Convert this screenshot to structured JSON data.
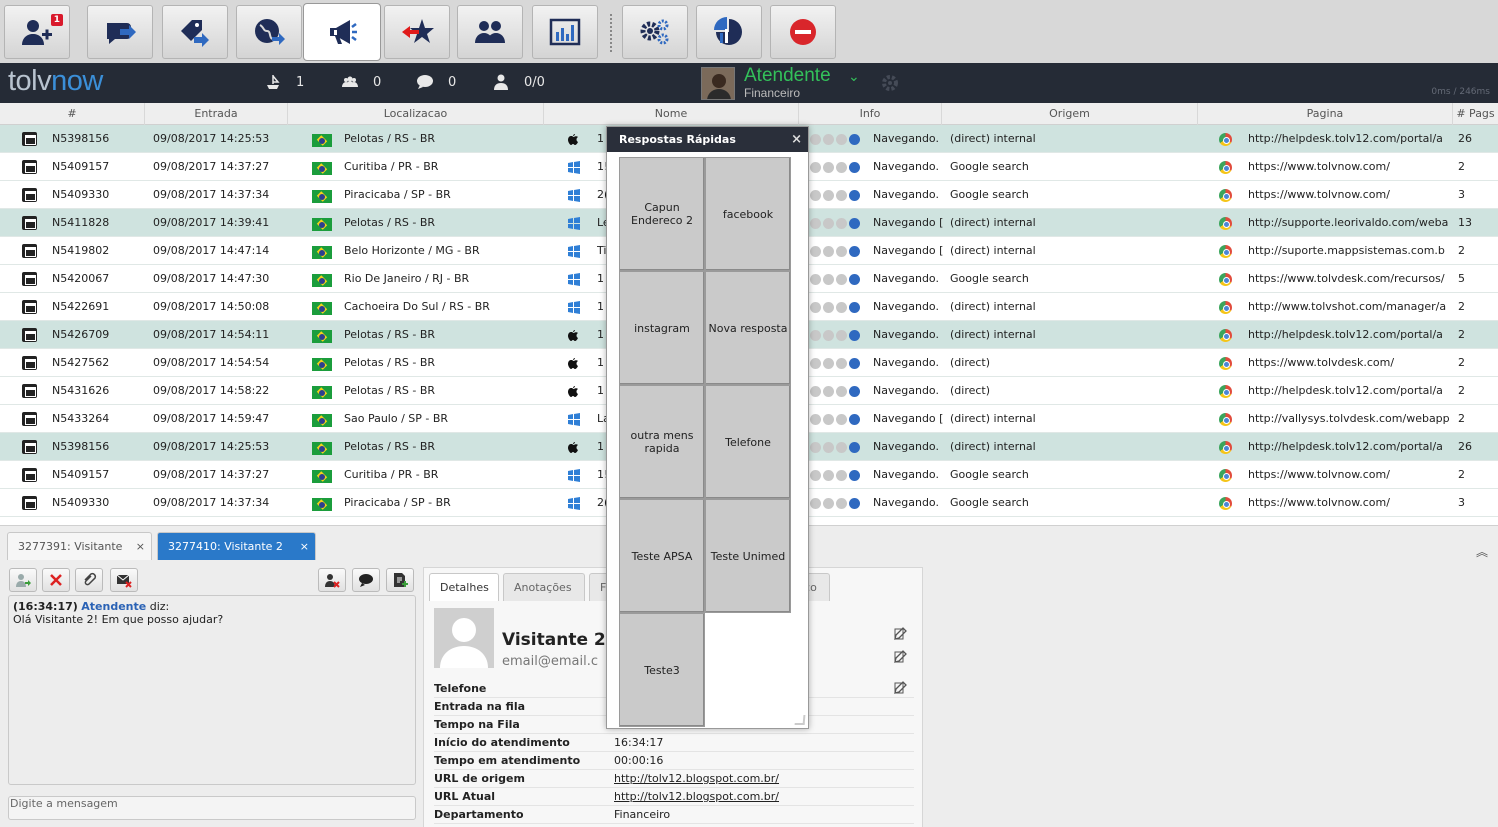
{
  "toolbar": {
    "badge": "1",
    "icons": [
      "add-user-icon",
      "chat-transfer-icon",
      "tags-icon",
      "globe-icon",
      "megaphone-icon",
      "star-icon",
      "users-icon",
      "chart-icon",
      "gears-icon",
      "pie-chart-icon",
      "stop-icon"
    ]
  },
  "status": {
    "logo_a": "tolv",
    "logo_b": "now",
    "stat1": "1",
    "stat2": "0",
    "stat3": "0",
    "stat4": "0/0",
    "agent_name": "Atendente",
    "agent_dept": "Financeiro",
    "timing": "0ms / 246ms",
    "accent": "#33c15a"
  },
  "table": {
    "headers": [
      "#",
      "Entrada",
      "Localizacao",
      "Nome",
      "Info",
      "Origem",
      "Pagina",
      "# Pags"
    ],
    "rows": [
      {
        "id": "N5398156",
        "entrada": "09/08/2017 14:25:53",
        "loc": "Pelotas / RS - BR",
        "os": "apple",
        "nome": "1",
        "info": "Navegando.",
        "origem": "(direct) internal",
        "pagina": "http://helpdesk.tolv12.com/portal/a",
        "pags": "26"
      },
      {
        "id": "N5409157",
        "entrada": "09/08/2017 14:37:27",
        "loc": "Curitiba / PR - BR",
        "os": "windows",
        "nome": "1!",
        "info": "Navegando.",
        "origem": "Google search",
        "pagina": "https://www.tolvnow.com/",
        "pags": "2"
      },
      {
        "id": "N5409330",
        "entrada": "09/08/2017 14:37:34",
        "loc": "Piracicaba / SP - BR",
        "os": "windows",
        "nome": "2(",
        "info": "Navegando.",
        "origem": "Google search",
        "pagina": "https://www.tolvnow.com/",
        "pags": "3"
      },
      {
        "id": "N5411828",
        "entrada": "09/08/2017 14:39:41",
        "loc": "Pelotas / RS - BR",
        "os": "windows",
        "nome": "Le",
        "info": "Navegando [",
        "origem": "(direct) internal",
        "pagina": "http://supporte.leorivaldo.com/weba",
        "pags": "13"
      },
      {
        "id": "N5419802",
        "entrada": "09/08/2017 14:47:14",
        "loc": "Belo Horizonte / MG - BR",
        "os": "windows",
        "nome": "Ti",
        "info": "Navegando [",
        "origem": "(direct) internal",
        "pagina": "http://suporte.mappsistemas.com.b",
        "pags": "2"
      },
      {
        "id": "N5420067",
        "entrada": "09/08/2017 14:47:30",
        "loc": "Rio De Janeiro / RJ - BR",
        "os": "windows",
        "nome": "1",
        "info": "Navegando.",
        "origem": "Google search",
        "pagina": "https://www.tolvdesk.com/recursos/",
        "pags": "5"
      },
      {
        "id": "N5422691",
        "entrada": "09/08/2017 14:50:08",
        "loc": "Cachoeira Do Sul / RS - BR",
        "os": "windows",
        "nome": "1",
        "info": "Navegando.",
        "origem": "(direct) internal",
        "pagina": "http://www.tolvshot.com/manager/a",
        "pags": "2"
      },
      {
        "id": "N5426709",
        "entrada": "09/08/2017 14:54:11",
        "loc": "Pelotas / RS - BR",
        "os": "apple",
        "nome": "1",
        "info": "Navegando.",
        "origem": "(direct) internal",
        "pagina": "http://helpdesk.tolv12.com/portal/a",
        "pags": "2"
      },
      {
        "id": "N5427562",
        "entrada": "09/08/2017 14:54:54",
        "loc": "Pelotas / RS - BR",
        "os": "apple",
        "nome": "1",
        "info": "Navegando.",
        "origem": "(direct)",
        "pagina": "https://www.tolvdesk.com/",
        "pags": "2"
      },
      {
        "id": "N5431626",
        "entrada": "09/08/2017 14:58:22",
        "loc": "Pelotas / RS - BR",
        "os": "apple",
        "nome": "1",
        "info": "Navegando.",
        "origem": "(direct)",
        "pagina": "http://helpdesk.tolv12.com/portal/a",
        "pags": "2"
      },
      {
        "id": "N5433264",
        "entrada": "09/08/2017 14:59:47",
        "loc": "Sao Paulo / SP - BR",
        "os": "windows",
        "nome": "La",
        "info": "Navegando [",
        "origem": "(direct) internal",
        "pagina": "http://vallysys.tolvdesk.com/webapp",
        "pags": "2"
      },
      {
        "id": "N5398156",
        "entrada": "09/08/2017 14:25:53",
        "loc": "Pelotas / RS - BR",
        "os": "apple",
        "nome": "1",
        "info": "Navegando.",
        "origem": "(direct) internal",
        "pagina": "http://helpdesk.tolv12.com/portal/a",
        "pags": "26"
      },
      {
        "id": "N5409157",
        "entrada": "09/08/2017 14:37:27",
        "loc": "Curitiba / PR - BR",
        "os": "windows",
        "nome": "1!",
        "info": "Navegando.",
        "origem": "Google search",
        "pagina": "https://www.tolvnow.com/",
        "pags": "2"
      },
      {
        "id": "N5409330",
        "entrada": "09/08/2017 14:37:34",
        "loc": "Piracicaba / SP - BR",
        "os": "windows",
        "nome": "2(",
        "info": "Navegando.",
        "origem": "Google search",
        "pagina": "https://www.tolvnow.com/",
        "pags": "3"
      }
    ]
  },
  "chat": {
    "tab1": "3277391: Visitante",
    "tab2": "3277410: Visitante 2",
    "close": "×",
    "msg_time": "(16:34:17)",
    "msg_author": "Atendente",
    "msg_said": "diz:",
    "msg_text": "Olá Visitante 2! Em que posso ajudar?",
    "input_placeholder": "Digite a mensagem"
  },
  "details": {
    "tabs": [
      "Detalhes",
      "Anotações",
      "F",
      "ico"
    ],
    "name": "Visitante 2",
    "email": "email@email.c",
    "rows": [
      {
        "label": "Telefone",
        "value": ""
      },
      {
        "label": "Entrada na fila",
        "value": ""
      },
      {
        "label": "Tempo na Fila",
        "value": ""
      },
      {
        "label": "Início do atendimento",
        "value": "16:34:17"
      },
      {
        "label": "Tempo em atendimento",
        "value": "00:00:16"
      },
      {
        "label": "URL de origem",
        "value": "http://tolv12.blogspot.com.br/"
      },
      {
        "label": "URL Atual",
        "value": "http://tolv12.blogspot.com.br/"
      },
      {
        "label": "Departamento",
        "value": "Financeiro"
      }
    ]
  },
  "modal": {
    "title": "Respostas Rápidas",
    "close": "×",
    "items": [
      "Capun Endereco 2",
      "facebook",
      "instagram",
      "Nova resposta",
      "outra mens rapida",
      "Telefone",
      "Teste APSA",
      "Teste Unimed",
      "Teste3"
    ]
  }
}
